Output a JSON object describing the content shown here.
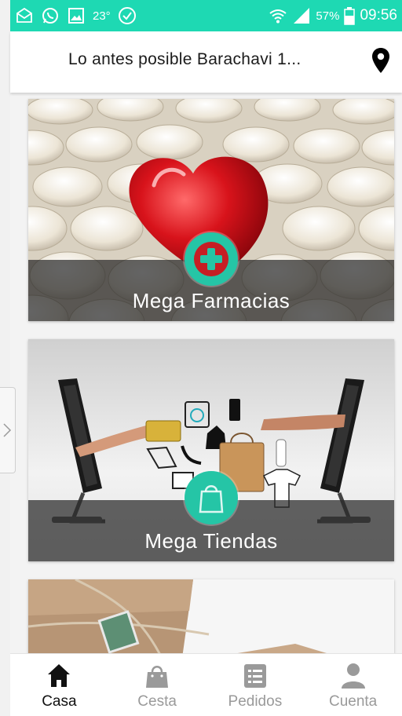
{
  "status_bar": {
    "temperature": "23°",
    "battery": "57%",
    "time": "09:56",
    "icons": [
      "mail-icon",
      "whatsapp-icon",
      "gallery-icon",
      "check-circle-icon",
      "wifi-icon",
      "signal-icon",
      "battery-icon"
    ]
  },
  "header": {
    "title": "Lo antes posible Barachavi 1...",
    "icon": "location-pin-icon"
  },
  "cards": [
    {
      "label": "Mega Farmacias",
      "icon": "medical-cross-icon"
    },
    {
      "label": "Mega Tiendas",
      "icon": "shopping-bag-icon"
    },
    {
      "label": "",
      "icon": "parcel-image"
    }
  ],
  "bottom_nav": {
    "items": [
      {
        "label": "Casa",
        "icon": "home-icon",
        "active": true
      },
      {
        "label": "Cesta",
        "icon": "basket-icon",
        "active": false
      },
      {
        "label": "Pedidos",
        "icon": "orders-list-icon",
        "active": false
      },
      {
        "label": "Cuenta",
        "icon": "account-icon",
        "active": false
      }
    ]
  },
  "colors": {
    "accent": "#1ed9b3",
    "badge": "#25c5a6",
    "active_text": "#111111",
    "inactive_text": "#9a9a9a"
  }
}
